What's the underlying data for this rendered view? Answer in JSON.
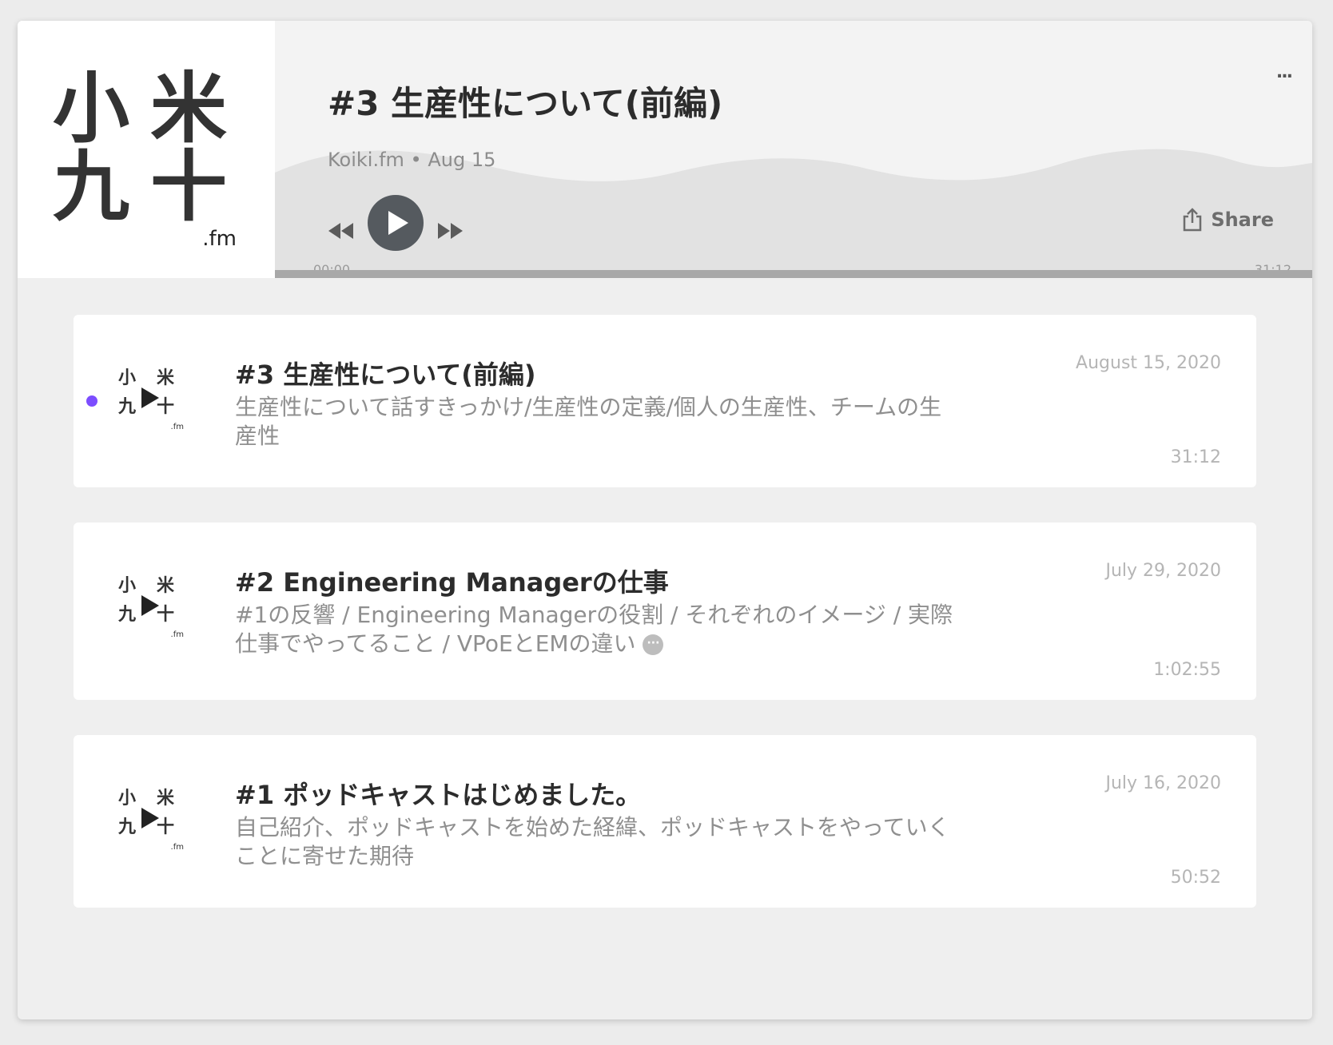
{
  "player": {
    "artwork": {
      "glyph_1": "小",
      "glyph_2": "米",
      "glyph_3": "九",
      "glyph_4": "十",
      "suffix": ".fm"
    },
    "title": "#3 生産性について(前編)",
    "meta": "Koiki.fm • Aug 15",
    "more_label": "...",
    "share_label": "Share",
    "time_start": "00:00",
    "time_end": "31:12",
    "progress_fraction": 0.0,
    "icons": [
      "rewind-icon",
      "play-icon",
      "fast-forward-icon",
      "share-icon",
      "more-icon"
    ]
  },
  "episodes": [
    {
      "title": "#3 生産性について(前編)",
      "description": "生産性について話すきっかけ/生産性の定義/個人の生産性、チームの生産性",
      "date": "August 15, 2020",
      "duration": "31:12",
      "current": true
    },
    {
      "title": "#2 Engineering Managerの仕事",
      "description": "#1の反響 / Engineering Managerの役割 / それぞれのイメージ / 実際仕事でやってること / VPoEとEMの違い",
      "more_indicator": "···",
      "date": "July 29, 2020",
      "duration": "1:02:55",
      "current": false
    },
    {
      "title": "#1 ポッドキャストはじめました。",
      "description": "自己紹介、ポッドキャストを始めた経緯、ポッドキャストをやっていくことに寄せた期待",
      "date": "July 16, 2020",
      "duration": "50:52",
      "current": false
    }
  ],
  "colors": {
    "accent_dot": "#7c4dff",
    "play_button": "#555a5f",
    "title_text": "#2c2c2c",
    "muted_text": "#8f8f8f",
    "progress_track": "#a8a8a8"
  }
}
